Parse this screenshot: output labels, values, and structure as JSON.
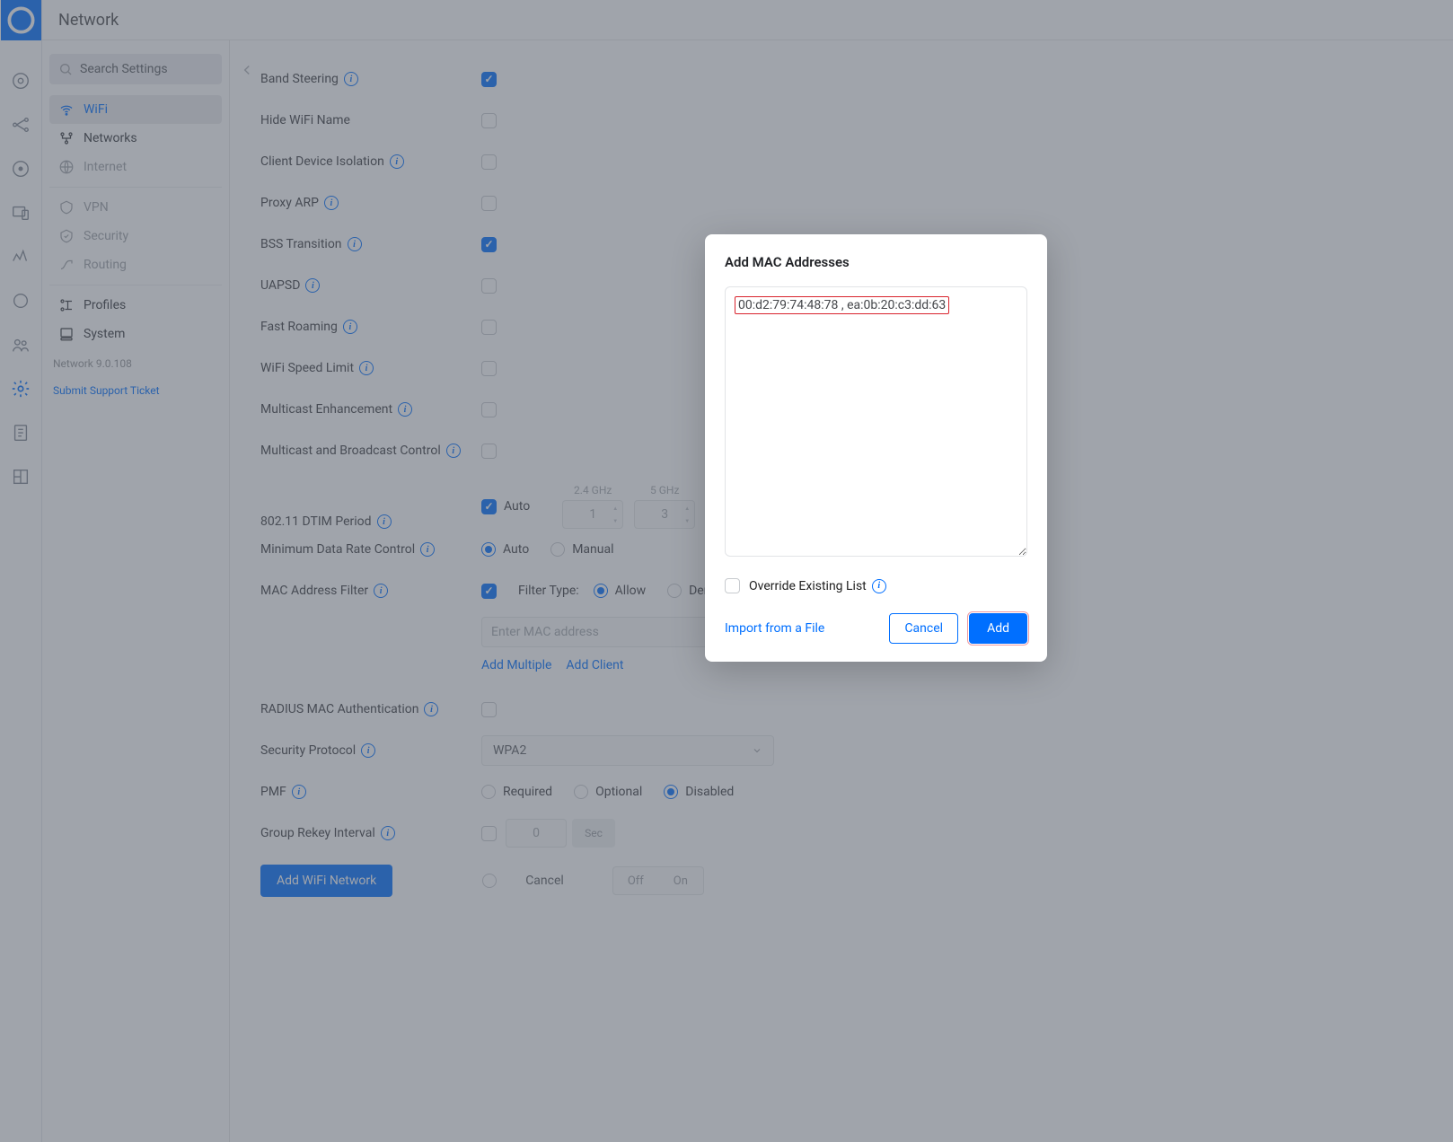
{
  "header": {
    "title": "Network"
  },
  "search": {
    "placeholder": "Search Settings"
  },
  "sidebar": {
    "items": [
      {
        "label": "WiFi"
      },
      {
        "label": "Networks"
      },
      {
        "label": "Internet"
      },
      {
        "label": "VPN"
      },
      {
        "label": "Security"
      },
      {
        "label": "Routing"
      },
      {
        "label": "Profiles"
      },
      {
        "label": "System"
      }
    ],
    "version": "Network 9.0.108",
    "support": "Submit Support Ticket"
  },
  "form": {
    "band_steering": "Band Steering",
    "hide_wifi": "Hide WiFi Name",
    "client_isolation": "Client Device Isolation",
    "proxy_arp": "Proxy ARP",
    "bss_transition": "BSS Transition",
    "uapsd": "UAPSD",
    "fast_roaming": "Fast Roaming",
    "wifi_speed_limit": "WiFi Speed Limit",
    "multicast_enh": "Multicast Enhancement",
    "multicast_bcast": "Multicast and Broadcast Control",
    "dtim": "802.11 DTIM Period",
    "dtim_auto": "Auto",
    "dtim_24": "2.4 GHz",
    "dtim_5": "5 GHz",
    "dtim_24_val": "1",
    "dtim_5_val": "3",
    "min_rate": "Minimum Data Rate Control",
    "rate_auto": "Auto",
    "rate_manual": "Manual",
    "mac_filter": "MAC Address Filter",
    "filter_type_label": "Filter Type:",
    "allow": "Allow",
    "deny": "Deny",
    "mac_placeholder": "Enter MAC address",
    "add_multiple": "Add Multiple",
    "add_client": "Add Client",
    "radius_mac": "RADIUS MAC Authentication",
    "security_proto": "Security Protocol",
    "security_value": "WPA2",
    "pmf": "PMF",
    "pmf_required": "Required",
    "pmf_optional": "Optional",
    "pmf_disabled": "Disabled",
    "group_rekey": "Group Rekey Interval",
    "rekey_val": "0",
    "rekey_unit": "Sec",
    "scheduler_off": "Off",
    "scheduler_on": "On",
    "add_wifi": "Add WiFi Network",
    "cancel": "Cancel"
  },
  "modal": {
    "title": "Add MAC Addresses",
    "value": "00:d2:79:74:48:78 , ea:0b:20:c3:dd:63",
    "override": "Override Existing List",
    "import": "Import from a File",
    "cancel": "Cancel",
    "add": "Add"
  }
}
